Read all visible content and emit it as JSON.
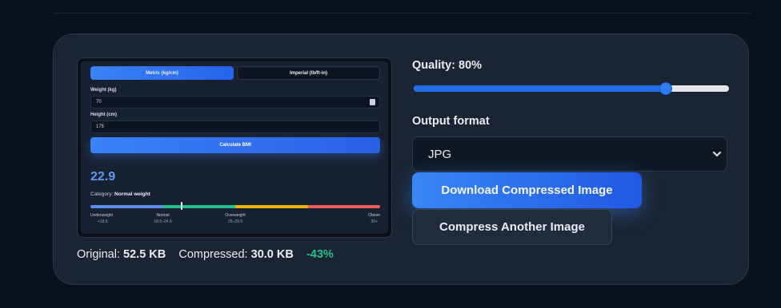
{
  "preview": {
    "tabs": {
      "metric": "Metric (kg/cm)",
      "imperial": "Imperial (lb/ft-in)"
    },
    "weight_label": "Weight (kg)",
    "weight_value": "70",
    "height_label": "Height (cm)",
    "height_value": "175",
    "calculate_label": "Calculate BMI",
    "bmi_value": "22.9",
    "category_prefix": "Category:",
    "category_value": "Normal weight",
    "marker_position": 0.315,
    "segments": [
      {
        "name": "Underweight",
        "range": "<18.5",
        "color": "#5b8def"
      },
      {
        "name": "Normal",
        "range": "18.5–24.9",
        "color": "#22c08d"
      },
      {
        "name": "Overweight",
        "range": "25–29.9",
        "color": "#eab308"
      },
      {
        "name": "Obese",
        "range": "30+",
        "color": "#ef5b5b"
      }
    ]
  },
  "stats": {
    "original_label": "Original:",
    "original_value": "52.5 KB",
    "compressed_label": "Compressed:",
    "compressed_value": "30.0 KB",
    "reduction": "-43%"
  },
  "quality": {
    "label": "Quality: 80%",
    "value": 0.8
  },
  "output_format": {
    "label": "Output format",
    "selected": "JPG"
  },
  "buttons": {
    "download": "Download Compressed Image",
    "compress_another": "Compress Another Image"
  },
  "colors": {
    "accent": "#3b82f6",
    "success": "#22c08d",
    "card_bg": "#1b2433",
    "page_bg": "#0b111c"
  }
}
